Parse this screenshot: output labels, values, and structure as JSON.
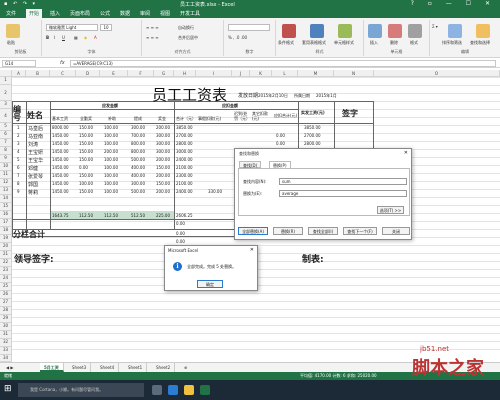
{
  "titlebar": {
    "title": "员工工资表.xlsx - Excel",
    "quick_access": "▪ ↶ ↷ ▾",
    "window_controls": "? ▫ — ☐ ✕"
  },
  "tabs": [
    "文件",
    "开始",
    "插入",
    "页面布局",
    "公式",
    "数据",
    "审阅",
    "视图",
    "开发工具"
  ],
  "ribbon": {
    "groups": [
      "剪贴板",
      "字体",
      "对齐方式",
      "数字",
      "样式",
      "单元格",
      "编辑"
    ],
    "font_name": "微软雅黑 Light",
    "font_size": "10",
    "paste": "粘贴",
    "cond_format": "条件格式",
    "table_format": "套用表格格式",
    "cell_style": "单元格样式",
    "insert": "插入",
    "delete": "删除",
    "format": "格式",
    "sort": "排序和筛选",
    "find": "查找和选择",
    "wrap": "自动换行",
    "merge": "合并后居中"
  },
  "formula_bar": {
    "name_box": "G14",
    "fx": "fx",
    "formula": "=AVERAGE(C9:C13)"
  },
  "columns": [
    "A",
    "B",
    "C",
    "D",
    "E",
    "F",
    "G",
    "H",
    "I",
    "J",
    "K",
    "L",
    "M",
    "N",
    "O"
  ],
  "rows": [
    "1",
    "2",
    "3",
    "4",
    "5",
    "6",
    "7",
    "8",
    "9",
    "10",
    "11",
    "12",
    "13",
    "14",
    "15",
    "16",
    "17",
    "18",
    "19",
    "20",
    "21",
    "22",
    "23",
    "24",
    "25",
    "26",
    "27",
    "28",
    "29",
    "30",
    "31",
    "32",
    "33",
    "34"
  ],
  "sheet": {
    "title": "员工工资表",
    "issue_date_label": "发放日期",
    "issue_date": "2015年2月10日",
    "month_label": "所属日期",
    "month": "2015年1月",
    "col_no": "编号",
    "col_name": "姓名",
    "pay_group": "应发金额",
    "deduct_group": "应扣金额",
    "col_actual": "实发工资(元)",
    "col_sign": "签字",
    "sub_headers": [
      "基本工资",
      "全勤奖",
      "补助",
      "提成",
      "奖金",
      "合计（元）",
      "事假扣款(元)",
      "迟到/处罚（元）",
      "其它扣款(元)",
      "应扣合计(元)"
    ],
    "rows": [
      {
        "no": "1",
        "name": "马皇后",
        "vals": [
          "8000.00",
          "150.00",
          "100.00",
          "300.00",
          "200.00",
          "3850.00"
        ],
        "deduct_total": "",
        "actual": "3850.00"
      },
      {
        "no": "2",
        "name": "马亚南",
        "vals": [
          "1450.00",
          "150.00",
          "100.00",
          "700.00",
          "300.00",
          "2700.00"
        ],
        "deduct_total": "0.00",
        "actual": "2700.00"
      },
      {
        "no": "3",
        "name": "刘涛",
        "vals": [
          "1450.00",
          "150.00",
          "100.00",
          "800.00",
          "300.00",
          "2800.00"
        ],
        "deduct_total": "0.00",
        "actual": "2800.00"
      },
      {
        "no": "4",
        "name": "王宝妍",
        "vals": [
          "1450.00",
          "150.00",
          "200.00",
          "800.00",
          "300.00",
          "3000.00"
        ],
        "deduct_total": "0.00",
        "actual": "3000.00"
      },
      {
        "no": "5",
        "name": "王宝华",
        "vals": [
          "1450.00",
          "150.00",
          "100.00",
          "500.00",
          "200.00",
          "2400.00"
        ],
        "deduct_total": "0.00",
        "actual": "2400.00"
      },
      {
        "no": "6",
        "name": "邓健",
        "vals": [
          "1450.00",
          "0.00",
          "100.00",
          "400.00",
          "150.00",
          "2100.00"
        ],
        "deduct_total": "",
        "actual": "2100.00"
      },
      {
        "no": "7",
        "name": "张爱琴",
        "vals": [
          "1450.00",
          "150.00",
          "100.00",
          "400.00",
          "200.00",
          "2300.00"
        ],
        "deduct_total": "0.00",
        "actual": "2300.00"
      },
      {
        "no": "8",
        "name": "郭国",
        "vals": [
          "1450.00",
          "100.00",
          "100.00",
          "300.00",
          "150.00",
          "2100.00"
        ],
        "deduct_total": "",
        "actual": "2100.00"
      },
      {
        "no": "9",
        "name": "蒋莉",
        "vals": [
          "1450.00",
          "150.00",
          "100.00",
          "500.00",
          "200.00",
          "2400.00"
        ],
        "deduct_total": "",
        "actual": "2400.00"
      },
      {
        "no": "",
        "name": "",
        "vals": [
          "1643.75",
          "112.50",
          "112.50",
          "512.50",
          "225.00",
          "2606.25"
        ],
        "deduct_total": "",
        "actual": ""
      }
    ],
    "extra_deduct": "330.00",
    "zeros": [
      "0.00",
      "0.00",
      "0.00"
    ],
    "subtotal_label": "分栏合计",
    "subtotal_value": "22926.25",
    "leader_sign": "领导签字:",
    "maker": "制表:"
  },
  "find_dialog": {
    "title": "查找和替换",
    "tab_find": "查找(D)",
    "tab_replace": "替换(P)",
    "find_label": "查找内容(N):",
    "find_value": "sum",
    "replace_label": "替换为(E):",
    "replace_value": "average",
    "options": "选项(T) >>",
    "btn_replace_all": "全部替换(A)",
    "btn_replace": "替换(R)",
    "btn_find_all": "查找全部(I)",
    "btn_find_next": "查找下一个(F)",
    "btn_close": "关闭"
  },
  "message_box": {
    "title": "Microsoft Excel",
    "icon": "i",
    "text": "全部完成。完成 5 处替换。",
    "ok": "确定"
  },
  "sheet_tabs": [
    "5月工资",
    "Sheet3",
    "Sheet4",
    "Sheet1",
    "Sheet2"
  ],
  "status": {
    "left": "就绪",
    "right": "平均值: 4170.00   计数: 6   求和: 25020.00"
  },
  "taskbar": {
    "search": "我是 Cortana，小娜。有问题尽管问我。"
  },
  "watermark": {
    "site": "jb51.net",
    "brand": "脚本之家"
  },
  "colors": {
    "excel_green": "#217346",
    "selection": "#c6dfcf",
    "taskbar": "#1c2a38",
    "watermark": "#bb3333"
  }
}
